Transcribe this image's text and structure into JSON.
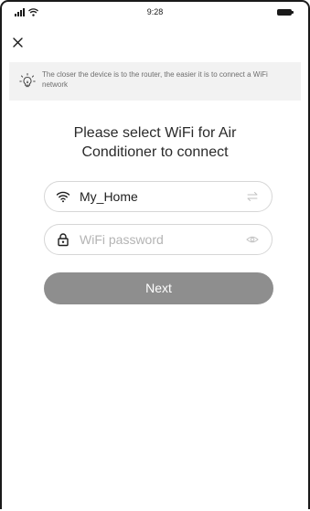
{
  "status_bar": {
    "time": "9:28"
  },
  "header": {
    "close_icon": "close-icon"
  },
  "tip": {
    "icon": "lightbulb-icon",
    "text": "The closer the device is to the router, the easier it is to connect a WiFi network"
  },
  "title": "Please select WiFi for Air Conditioner to connect",
  "wifi_field": {
    "icon": "wifi-icon",
    "value": "My_Home",
    "trailing_icon": "switch-network-icon"
  },
  "password_field": {
    "icon": "lock-icon",
    "placeholder": "WiFi password",
    "value": "",
    "trailing_icon": "eye-icon"
  },
  "next_button": {
    "label": "Next",
    "color": "#8e8e8e"
  }
}
